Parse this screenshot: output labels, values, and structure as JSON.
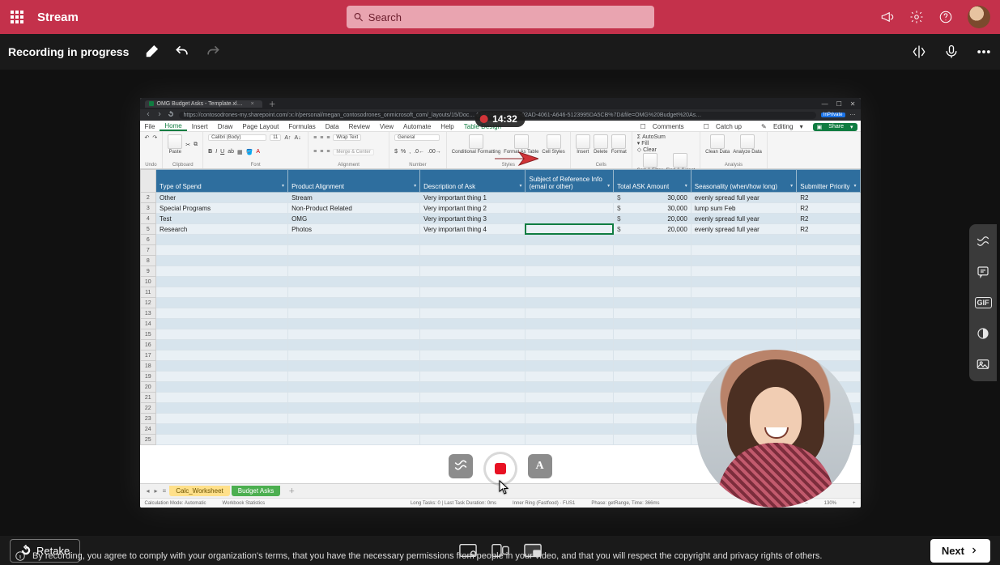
{
  "app": {
    "name": "Stream",
    "search_placeholder": "Search"
  },
  "recording": {
    "status": "Recording in progress",
    "timer": "14:32"
  },
  "browser": {
    "tab_title": "OMG Budget Asks - Template.xl…",
    "url": "https://contosodrones-my.sharepoint.com/:x:/r/personal/megan_contosodrones_onmicrosoft_com/_layouts/15/Doc… 679F8C9563E3E-02AD-4061-A646-5123995DA5CB%7D&file=OMG%20Budget%20As…",
    "profile_badge": "InPrivate"
  },
  "excel": {
    "menubar": [
      "File",
      "Home",
      "Insert",
      "Draw",
      "Page Layout",
      "Formulas",
      "Data",
      "Review",
      "View",
      "Automate",
      "Help",
      "Table Design"
    ],
    "active_tab": "Home",
    "extra_tab": "Table Design",
    "right_actions": {
      "comments": "Comments",
      "catchup": "Catch up",
      "editing": "Editing",
      "share": "Share"
    },
    "ribbon": {
      "font_name": "Calibri (Body)",
      "font_size": "11",
      "number_format": "General",
      "groups": [
        "Undo",
        "Clipboard",
        "Font",
        "Alignment",
        "Number",
        "Styles",
        "Cells",
        "Editing",
        "Analysis"
      ],
      "wrap_text": "Wrap Text",
      "merge_center": "Merge & Center",
      "cond_fmt": "Conditional Formatting",
      "fmt_table": "Format As Table",
      "cell_styles": "Cell Styles",
      "insert": "Insert",
      "delete": "Delete",
      "format": "Format",
      "autosum": "AutoSum",
      "fill": "Fill",
      "clear": "Clear",
      "sort_filter": "Sort & Filter",
      "find_select": "Find & Select",
      "analyze": "Analyze Data",
      "clean": "Clean Data"
    },
    "headers": [
      "Type of Spend",
      "Product Alignment",
      "Description of Ask",
      "Subject of Reference Info (email or other)",
      "Total ASK Amount",
      "Seasonality (when/how long)",
      "Submitter Priority"
    ],
    "rows": [
      {
        "n": "2",
        "type": "Other",
        "align": "Stream",
        "desc": "Very important thing 1",
        "subj": "",
        "amt": "30,000",
        "seas": "evenly spread full year",
        "pri": "R2"
      },
      {
        "n": "3",
        "type": "Special Programs",
        "align": "Non-Product Related",
        "desc": "Very important thing 2",
        "subj": "",
        "amt": "30,000",
        "seas": "lump sum Feb",
        "pri": "R2"
      },
      {
        "n": "4",
        "type": "Test",
        "align": "OMG",
        "desc": "Very important thing 3",
        "subj": "",
        "amt": "20,000",
        "seas": "evenly spread full year",
        "pri": "R2"
      },
      {
        "n": "5",
        "type": "Research",
        "align": "Photos",
        "desc": "Very important thing 4",
        "subj": "",
        "amt": "20,000",
        "seas": "evenly spread full year",
        "pri": "R2"
      }
    ],
    "empty_rows": [
      "6",
      "7",
      "8",
      "9",
      "10",
      "11",
      "12",
      "13",
      "14",
      "15",
      "16",
      "17",
      "18",
      "19",
      "20",
      "21",
      "22",
      "23",
      "24",
      "25"
    ],
    "sheet_tabs": [
      {
        "label": "Calc_Worksheet",
        "color": "yellow"
      },
      {
        "label": "Budget Asks",
        "color": "green"
      }
    ],
    "status": {
      "calc_mode": "Calculation Mode: Automatic",
      "wb_stats": "Workbook Statistics",
      "long_tasks": "Long Tasks: 0 | Last Task Duration: 0ms",
      "inner_ring": "Inner Ring (Fastfood) · FUS1",
      "phase": "Phase: getRange, Time: 366ms",
      "zoom": "130%"
    }
  },
  "capture_controls": {
    "clear": "clear",
    "stop": "stop",
    "text": "A"
  },
  "footer": {
    "retake": "Retake",
    "next": "Next",
    "disclaimer": "By recording, you agree to comply with your organization's terms, that you have the necessary permissions from people in your video, and that you will respect the copyright and privacy rights of others."
  }
}
